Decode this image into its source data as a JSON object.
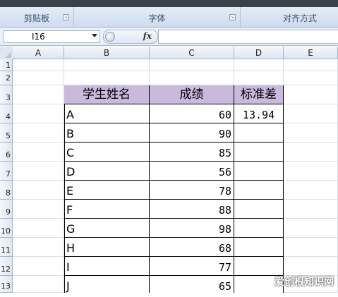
{
  "ribbon": {
    "groups": [
      {
        "label": "剪贴板"
      },
      {
        "label": "字体"
      },
      {
        "label": "对齐方式"
      }
    ]
  },
  "formula_bar": {
    "name_box": "I16",
    "fx_label": "fx",
    "formula": ""
  },
  "columns": [
    "A",
    "B",
    "C",
    "D",
    "E"
  ],
  "rows": [
    "1",
    "2",
    "3",
    "4",
    "5",
    "6",
    "7",
    "8",
    "9",
    "10",
    "11",
    "12",
    "13"
  ],
  "table": {
    "headers": [
      "学生姓名",
      "成绩",
      "标准差"
    ],
    "rows": [
      {
        "name": "A",
        "score": "60",
        "std": "13.94"
      },
      {
        "name": "B",
        "score": "90",
        "std": ""
      },
      {
        "name": "C",
        "score": "85",
        "std": ""
      },
      {
        "name": "D",
        "score": "56",
        "std": ""
      },
      {
        "name": "E",
        "score": "78",
        "std": ""
      },
      {
        "name": "F",
        "score": "88",
        "std": ""
      },
      {
        "name": "G",
        "score": "98",
        "std": ""
      },
      {
        "name": "H",
        "score": "68",
        "std": ""
      },
      {
        "name": "I",
        "score": "77",
        "std": ""
      },
      {
        "name": "J",
        "score": "65",
        "std": ""
      }
    ]
  },
  "watermark": "爱创根知识网",
  "colors": {
    "header_fill": "#c9b9dd",
    "ribbon": "#dce6f4"
  }
}
